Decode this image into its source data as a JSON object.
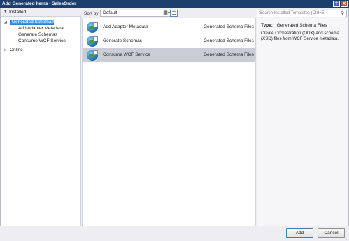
{
  "window": {
    "title": "Add Generated Items - SalesOrder",
    "help_label": "?",
    "close_label": "X"
  },
  "tree": {
    "header": "Installed",
    "nodes": [
      {
        "label": "Generated Schema Files",
        "selected": true,
        "expanded": true
      },
      {
        "label": "Add Adapter Metadata"
      },
      {
        "label": "Generate Schemas"
      },
      {
        "label": "Consume WCF Service"
      },
      {
        "label": "Online",
        "expanded": false
      }
    ]
  },
  "toolbar": {
    "sort_label": "Sort by:",
    "sort_value": "Default"
  },
  "search": {
    "placeholder": "Search Installed Templates (Ctrl+E)"
  },
  "templates": [
    {
      "name": "Add Adapter Metadata",
      "category": "Generated Schema Files",
      "selected": false
    },
    {
      "name": "Generate Schemas",
      "category": "Generated Schema Files",
      "selected": false
    },
    {
      "name": "Consume WCF Service",
      "category": "Generated Schema Files",
      "selected": true
    }
  ],
  "details": {
    "type_label": "Type:",
    "type_value": "Generated Schema Files",
    "description": "Create Orchestration (ODX) and schema (XSD) files from WCF Service metadata."
  },
  "buttons": {
    "add": "Add",
    "cancel": "Cancel"
  }
}
